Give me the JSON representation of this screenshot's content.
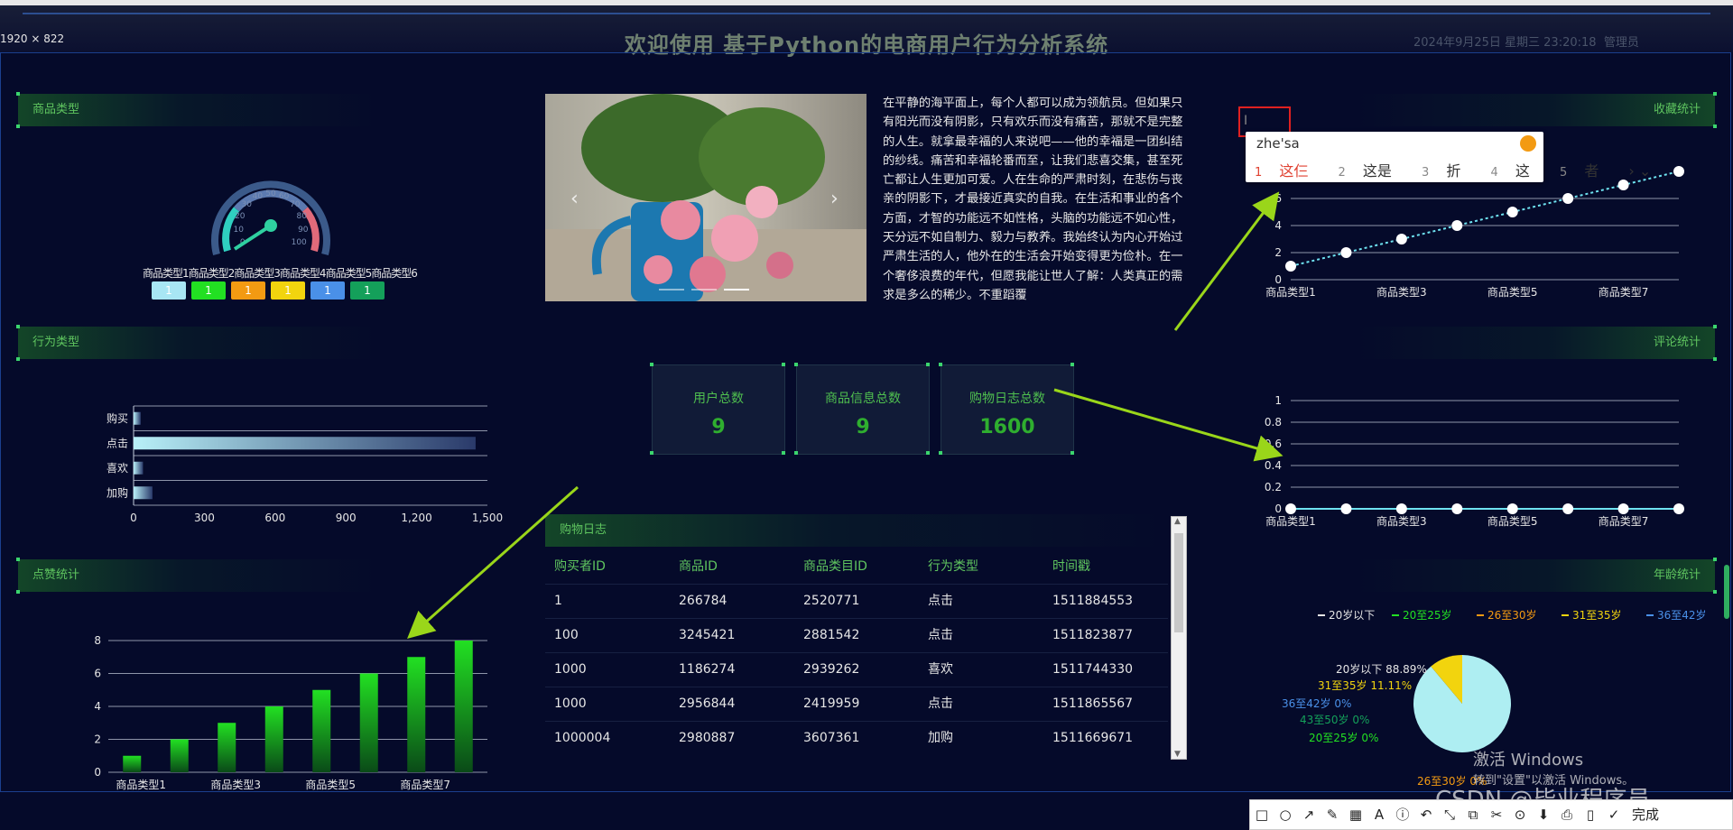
{
  "window": {
    "dimension_label": "1920 × 822",
    "title": "欢迎使用 基于Python的电商用户行为分析系统",
    "datetime": "2024年9月25日 星期三 23:20:18",
    "user_label": "管理员"
  },
  "panels": {
    "product_type": "商品类型",
    "behavior_type": "行为类型",
    "like_stats": "点赞统计",
    "collect_stats": "收藏统计",
    "comment_stats": "评论统计",
    "age_stats": "年龄统计",
    "shop_log": "购物日志"
  },
  "gauge": {
    "tick_labels": [
      "30",
      "40",
      "50",
      "60",
      "70",
      "80",
      "90",
      "100",
      "20",
      "10",
      "0"
    ],
    "legend": [
      "商品类型1",
      "商品类型2",
      "商品类型3",
      "商品类型4",
      "商品类型5",
      "商品类型6"
    ],
    "values": [
      "1",
      "1",
      "1",
      "1",
      "1",
      "1"
    ],
    "colors": [
      "#a8e6f4",
      "#22e022",
      "#f39a12",
      "#f2d40e",
      "#4a90e8",
      "#14a05a"
    ],
    "needle_value": 1
  },
  "carousel": {
    "prev": "‹",
    "next": "›",
    "indicators": 3,
    "active": 1
  },
  "article": "在平静的海平面上，每个人都可以成为领航员。但如果只有阳光而没有阴影，只有欢乐而没有痛苦，那就不是完整的人生。就拿最幸福的人来说吧——他的幸福是一团纠结的纱线。痛苦和幸福轮番而至，让我们悲喜交集，甚至死亡都让人生更加可爱。人在生命的严肃时刻，在悲伤与丧亲的阴影下，才最接近真实的自我。在生活和事业的各个方面，才智的功能远不如性格，头脑的功能远不如心性，天分远不如自制力、毅力与教养。我始终认为内心开始过严肃生活的人，他外在的生活会开始变得更为俭朴。在一个奢侈浪费的年代，但愿我能让世人了解：人类真正的需求是多么的稀少。不重蹈覆",
  "stats": [
    {
      "label": "用户总数",
      "value": "9"
    },
    {
      "label": "商品信息总数",
      "value": "9"
    },
    {
      "label": "购物日志总数",
      "value": "1600"
    }
  ],
  "table": {
    "columns": [
      "购买者ID",
      "商品ID",
      "商品类目ID",
      "行为类型",
      "时间戳"
    ],
    "rows": [
      [
        "1",
        "266784",
        "2520771",
        "点击",
        "1511884553"
      ],
      [
        "100",
        "3245421",
        "2881542",
        "点击",
        "1511823877"
      ],
      [
        "1000",
        "1186274",
        "2939262",
        "喜欢",
        "1511744330"
      ],
      [
        "1000",
        "2956844",
        "2419959",
        "点击",
        "1511865567"
      ],
      [
        "1000004",
        "2980887",
        "3607361",
        "加购",
        "1511669671"
      ]
    ],
    "scroll_up": "▲",
    "scroll_down": "▼"
  },
  "ime": {
    "composition": "zhe'sa",
    "candidates": [
      {
        "num": "1",
        "word": "这仨"
      },
      {
        "num": "2",
        "word": "这是"
      },
      {
        "num": "3",
        "word": "折"
      },
      {
        "num": "4",
        "word": "这"
      },
      {
        "num": "5",
        "word": "者"
      }
    ],
    "more": "› ⌄"
  },
  "watermark": {
    "activate": "激活 Windows",
    "hint": "转到\"设置\"以激活 Windows。",
    "csdn": "CSDN @毕业程序员"
  },
  "toolbar": {
    "icons": [
      "□",
      "○",
      "↗",
      "✎",
      "▦",
      "A",
      "ⓘ",
      "↶",
      "⤡",
      "⧉",
      "✂",
      "⊙",
      "⬇",
      "⎙",
      "▯",
      "✓"
    ],
    "done": "完成"
  },
  "chart_data": [
    {
      "id": "behavior",
      "type": "bar",
      "orientation": "horizontal",
      "categories": [
        "购买",
        "点击",
        "喜欢",
        "加购"
      ],
      "values": [
        30,
        1450,
        40,
        80
      ],
      "xlim": [
        0,
        1500
      ],
      "xticks": [
        "0",
        "300",
        "600",
        "900",
        "1,200",
        "1,500"
      ],
      "grid": true
    },
    {
      "id": "like",
      "type": "bar",
      "categories": [
        "商品类型1",
        "商品类型2",
        "商品类型3",
        "商品类型4",
        "商品类型5",
        "商品类型6",
        "商品类型7",
        "商品类型8"
      ],
      "values": [
        1,
        2,
        3,
        4,
        5,
        6,
        7,
        8
      ],
      "ylim": [
        0,
        8
      ],
      "yticks": [
        "0",
        "2",
        "4",
        "6",
        "8"
      ],
      "xtick_labels": [
        "商品类型1",
        "商品类型3",
        "商品类型5",
        "商品类型7"
      ],
      "grid": true
    },
    {
      "id": "collect",
      "type": "line",
      "categories": [
        "商品类型1",
        "商品类型2",
        "商品类型3",
        "商品类型4",
        "商品类型5",
        "商品类型6",
        "商品类型7",
        "商品类型8"
      ],
      "values": [
        1,
        2,
        3,
        4,
        5,
        6,
        7,
        8
      ],
      "ylim": [
        0,
        8
      ],
      "yticks": [
        "0",
        "2",
        "4",
        "6"
      ],
      "xtick_labels": [
        "商品类型1",
        "商品类型3",
        "商品类型5",
        "商品类型7"
      ],
      "grid": true
    },
    {
      "id": "comment",
      "type": "line",
      "categories": [
        "商品类型1",
        "商品类型2",
        "商品类型3",
        "商品类型4",
        "商品类型5",
        "商品类型6",
        "商品类型7",
        "商品类型8"
      ],
      "values": [
        0,
        0,
        0,
        0,
        0,
        0,
        0,
        0
      ],
      "ylim": [
        0,
        1
      ],
      "yticks": [
        "0",
        "0.2",
        "0.4",
        "0.6",
        "0.8",
        "1"
      ],
      "xtick_labels": [
        "商品类型1",
        "商品类型3",
        "商品类型5",
        "商品类型7"
      ],
      "grid": true
    },
    {
      "id": "age",
      "type": "pie",
      "legend": [
        {
          "name": "20岁以下",
          "color": "#e6e6e6"
        },
        {
          "name": "20至25岁",
          "color": "#22e022"
        },
        {
          "name": "26至30岁",
          "color": "#f39a12"
        },
        {
          "name": "31至35岁",
          "color": "#f2d40e"
        },
        {
          "name": "36至42岁",
          "color": "#4a90e8"
        },
        {
          "name": "43至50岁",
          "color": "#14a05a"
        }
      ],
      "slices": [
        {
          "name": "20岁以下",
          "value": 88.89,
          "label": "20岁以下 88.89%",
          "color": "#aeeef2"
        },
        {
          "name": "31至35岁",
          "value": 11.11,
          "label": "31至35岁 11.11%",
          "color": "#f2d40e"
        },
        {
          "name": "36至42岁",
          "value": 0,
          "label": "36至42岁 0%",
          "color": "#4a90e8"
        },
        {
          "name": "43至50岁",
          "value": 0,
          "label": "43至50岁 0%",
          "color": "#14a05a"
        },
        {
          "name": "20至25岁",
          "value": 0,
          "label": "20至25岁 0%",
          "color": "#22e022"
        },
        {
          "name": "26至30岁",
          "value": 0,
          "label": "26至30岁 0%",
          "color": "#f39a12"
        }
      ]
    }
  ]
}
